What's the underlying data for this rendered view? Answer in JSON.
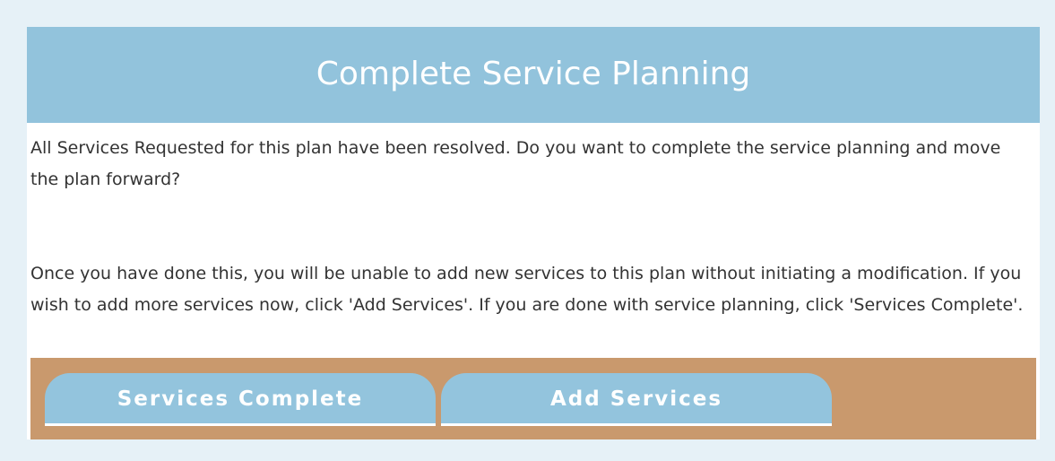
{
  "dialog": {
    "title": "Complete Service Planning",
    "paragraph_1": "All Services Requested for this plan have been resolved. Do you want to complete the service planning and move the plan forward?",
    "paragraph_2": "Once you have done this, you will be unable to add new services to this plan without initiating a modification. If you wish to add more services now, click 'Add Services'. If you are done with service planning, click 'Services Complete'."
  },
  "actions": {
    "services_complete_label": "Services Complete",
    "add_services_label": "Add Services"
  },
  "colors": {
    "page_background": "#e6f1f7",
    "header_background": "#92c3dc",
    "action_bar_background": "#c9996d",
    "button_background": "#93c4dd",
    "button_text": "#ffffff",
    "body_text": "#333333"
  }
}
